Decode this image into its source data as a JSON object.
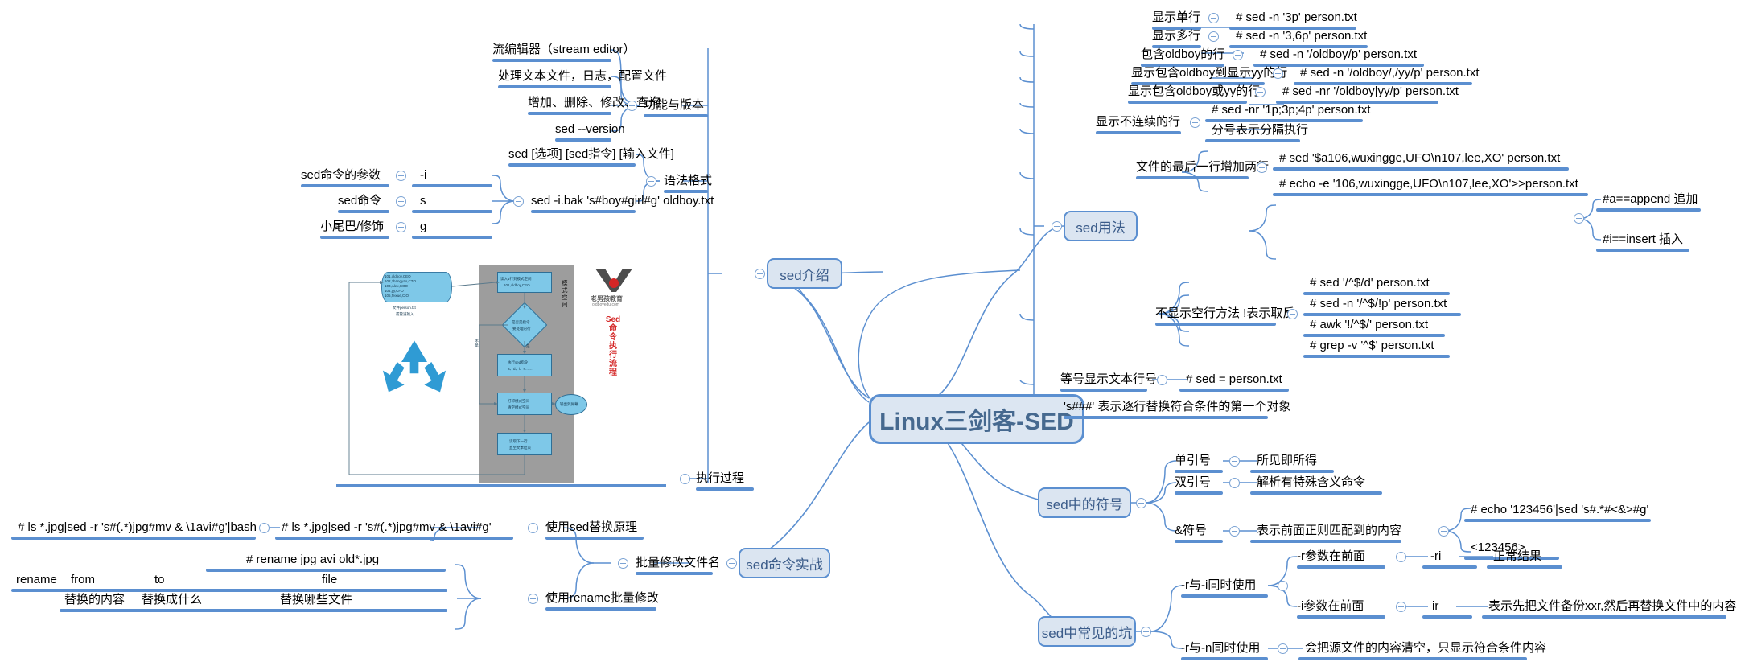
{
  "root": {
    "label": "Linux三剑客-SED"
  },
  "colors": {
    "branch": "#5b8fd0",
    "node_fill": "#dbe5f1",
    "node_text": "#3b5c8a",
    "leaf_text": "#000000"
  },
  "branches": {
    "sed_intro": {
      "label": "sed介绍",
      "children": {
        "features": {
          "label": "功能与版本",
          "items": [
            "流编辑器（stream editor）",
            "处理文本文件，日志，配置文件",
            "增加、删除、修改、查询",
            "sed --version"
          ]
        },
        "syntax": {
          "label": "语法格式",
          "items": [
            "sed [选项] [sed指令] [输入文件]"
          ],
          "example": {
            "label": "sed -i.bak 's#boy#girl#g' oldboy.txt",
            "parts": [
              {
                "name": "sed命令的参数",
                "value": "-i"
              },
              {
                "name": "sed命令",
                "value": "s"
              },
              {
                "name": "小尾巴/修饰",
                "value": "g"
              }
            ]
          }
        },
        "process": {
          "label": "执行过程"
        }
      }
    },
    "sed_usage": {
      "label": "sed用法",
      "items": [
        {
          "label": "显示单行",
          "cmds": [
            "# sed -n '3p' person.txt"
          ]
        },
        {
          "label": "显示多行",
          "cmds": [
            "# sed -n '3,6p' person.txt"
          ]
        },
        {
          "label": "包含oldboy的行",
          "cmds": [
            "# sed -n '/oldboy/p' person.txt"
          ]
        },
        {
          "label": "显示包含oldboy到显示yy的行",
          "cmds": [
            "# sed -n '/oldboy/,/yy/p' person.txt"
          ]
        },
        {
          "label": "显示包含oldboy或yy的行",
          "cmds": [
            "# sed -nr '/oldboy|yy/p' person.txt"
          ]
        },
        {
          "label": "显示不连续的行",
          "cmds": [
            "# sed -nr '1p;3p;4p' person.txt",
            "分号表示分隔执行"
          ]
        },
        {
          "label": "文件的最后一行增加两行",
          "cmds": [
            "# sed '$a106,wuxingge,UFO\\n107,lee,XO' person.txt",
            "# echo -e '106,wuxingge,UFO\\n107,lee,XO'>>person.txt"
          ],
          "notes": [
            "#a==append 追加",
            "#i==insert 插入"
          ]
        },
        {
          "label": "不显示空行方法 !表示取反",
          "cmds": [
            "# sed  '/^$/d' person.txt",
            "# sed -n '/^$/!p' person.txt",
            "# awk '!/^$/' person.txt",
            "# grep -v '^$' person.txt"
          ]
        },
        {
          "label": "等号显示文本行号",
          "cmds": [
            "# sed = person.txt"
          ]
        },
        {
          "label": "'s###'  表示逐行替换符合条件的第一个对象",
          "cmds": []
        }
      ]
    },
    "sed_symbols": {
      "label": "sed中的符号",
      "items": [
        {
          "label": "单引号",
          "desc": "所见即所得",
          "cmds": []
        },
        {
          "label": "双引号",
          "desc": "解析有特殊含义命令",
          "cmds": []
        },
        {
          "label": "&符号",
          "desc": "表示前面正则匹配到的内容",
          "cmds": [
            "# echo '123456'|sed 's#.*#<&>#g'",
            "<123456>"
          ]
        }
      ]
    },
    "sed_pitfalls": {
      "label": "sed中常见的坑",
      "items": [
        {
          "label": "-r与-i同时使用",
          "subs": [
            {
              "label": "-r参数在前面",
              "flag": "-ri",
              "desc": "正常结果"
            },
            {
              "label": "-i参数在前面",
              "flag": "ir",
              "desc": "表示先把文件备份xxr,然后再替换文件中的内容"
            }
          ]
        },
        {
          "label": "-r与-n同时使用",
          "desc": "会把源文件的内容清空，只显示符合条件内容",
          "subs": []
        }
      ]
    },
    "sed_practice": {
      "label": "sed命令实战",
      "children": {
        "batch_rename": {
          "label": "批量修改文件名",
          "items": [
            {
              "label": "使用sed替换原理",
              "cmds": [
                "# ls *.jpg|sed -r 's#(.*)jpg#mv & \\1avi#g'",
                "# ls *.jpg|sed -r 's#(.*)jpg#mv & \\1avi#g'|bash"
              ]
            },
            {
              "label": "使用rename批量修改",
              "cmds": [
                "# rename jpg avi old*.jpg"
              ],
              "table": {
                "row1": [
                  "rename",
                  "from",
                  "to",
                  "file"
                ],
                "row2": [
                  "",
                  "替换的内容",
                  "替换成什么",
                  "替换哪些文件"
                ]
              }
            }
          ]
        }
      }
    }
  },
  "embedded_image": {
    "title": "Sed 命令执行流程",
    "brand": "老男孩教育",
    "brand_url": "oldboyedu.com",
    "pattern_space_label": "模式空间",
    "input_lines": [
      "101,oldboy,CEO",
      "102,zhangyao,CTO",
      "103,Alex,COO",
      "104,yy,CFO",
      "105,feixue,CIO"
    ],
    "input_caption": [
      "文件person.txt",
      "或管道输入"
    ],
    "steps": [
      "读入1行到模式空间\n101,oldboy,CEO",
      "是否是指令\n要处理的行",
      "执行sed指令\na、d、i、s……",
      "打印模式空间\n清空模式空间",
      "读取下一行\n直至文本结束"
    ],
    "branch_labels": [
      "不是",
      "是"
    ],
    "output_label": "输出到屏幕"
  }
}
